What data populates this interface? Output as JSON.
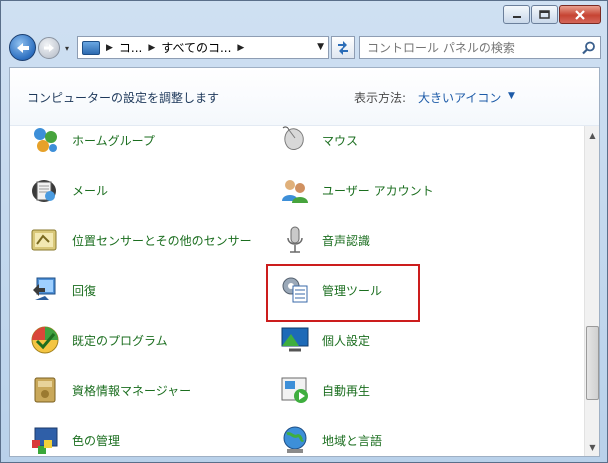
{
  "address": {
    "crumbs": [
      "コ...",
      "すべてのコ..."
    ],
    "search_placeholder": "コントロール パネルの検索"
  },
  "header": {
    "title": "コンピューターの設定を調整します",
    "view_label": "表示方法:",
    "view_value": "大きいアイコン"
  },
  "items_left": [
    {
      "label": "ホームグループ",
      "icon": "homegroup-icon"
    },
    {
      "label": "メール",
      "icon": "mail-icon"
    },
    {
      "label": "位置センサーとその他のセンサー",
      "icon": "location-sensor-icon"
    },
    {
      "label": "回復",
      "icon": "recovery-icon"
    },
    {
      "label": "既定のプログラム",
      "icon": "default-programs-icon"
    },
    {
      "label": "資格情報マネージャー",
      "icon": "credential-manager-icon"
    },
    {
      "label": "色の管理",
      "icon": "color-management-icon"
    }
  ],
  "items_right": [
    {
      "label": "マウス",
      "icon": "mouse-icon"
    },
    {
      "label": "ユーザー アカウント",
      "icon": "user-accounts-icon"
    },
    {
      "label": "音声認識",
      "icon": "microphone-icon"
    },
    {
      "label": "管理ツール",
      "icon": "admin-tools-icon"
    },
    {
      "label": "個人設定",
      "icon": "personalization-icon"
    },
    {
      "label": "自動再生",
      "icon": "autoplay-icon"
    },
    {
      "label": "地域と言語",
      "icon": "region-language-icon"
    }
  ],
  "colors": {
    "link_green": "#1b6e1f",
    "highlight_red": "#cc1d1d",
    "view_blue": "#1d5ba8"
  }
}
